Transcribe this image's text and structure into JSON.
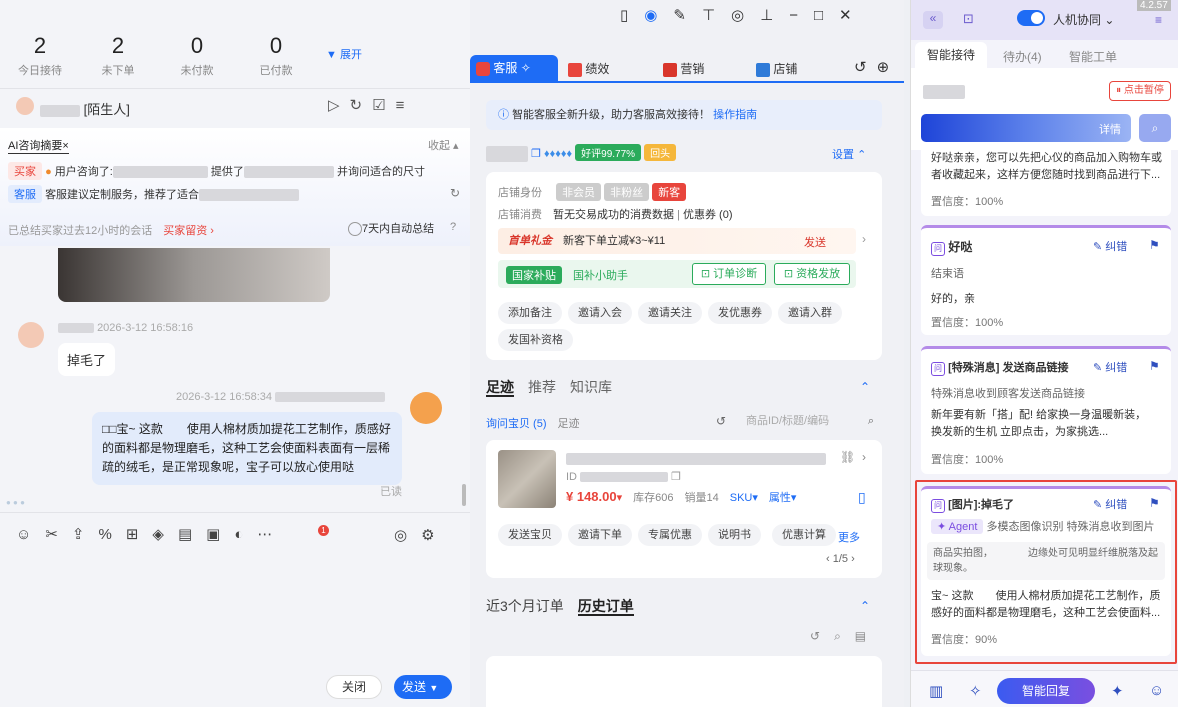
{
  "stats": [
    {
      "value": "2",
      "label": "今日接待"
    },
    {
      "value": "2",
      "label": "未下单"
    },
    {
      "value": "0",
      "label": "未付款"
    },
    {
      "value": "0",
      "label": "已付款"
    }
  ],
  "expand": "展开",
  "customer": {
    "tag": "[陌生人]"
  },
  "ai": {
    "title": "AI咨询摘要",
    "collapse": "收起",
    "buyer_label": "买家",
    "buyer_text1": "用户咨询了:",
    "buyer_text2": "提供了",
    "buyer_text3": "并询问适合的尺寸",
    "service_label": "客服",
    "service_text": "客服建议定制服务，推荐了适合",
    "summary": "已总结买家过去12小时的会话",
    "buyer_msg": "买家留资 ›",
    "auto": "7天内自动总结"
  },
  "chat": {
    "time1": "2026-3-12 16:58:16",
    "msg1": "掉毛了",
    "time2": "2026-3-12 16:58:34",
    "reply": "□□宝~ 这款　　使用人棉材质加提花工艺制作，质感好的面料都是物理磨毛，这种工艺会使面料表面有一层稀疏的绒毛，是正常现象呢，宝子可以放心使用哒",
    "read": "已读",
    "close": "关闭",
    "send": "发送"
  },
  "tabs": [
    "客服",
    "绩效",
    "营销",
    "店铺"
  ],
  "notice": {
    "text": "智能客服全新升级，助力客服高效接待！",
    "link": "操作指南"
  },
  "shop": {
    "rate": "好评99.77%",
    "badge": "回头",
    "settings": "设置"
  },
  "buyer": {
    "identity_label": "店铺身份",
    "identity_tags": [
      "非会员",
      "非粉丝",
      "新客"
    ],
    "consume_label": "店铺消费",
    "consume_value": "暂无交易成功的消费数据",
    "coupon": "优惠券 (0)",
    "gift_title": "首单礼金",
    "gift_desc": "新客下单立减¥3~¥11",
    "gift_send": "发送",
    "subsidy": "国家补贴",
    "subsidy_desc": "国补小助手",
    "diagnose": "订单诊断",
    "grant": "资格发放"
  },
  "actions": [
    "添加备注",
    "邀请入会",
    "邀请关注",
    "发优惠券",
    "邀请入群",
    "发国补资格"
  ],
  "foot_tabs": [
    "足迹",
    "推荐",
    "知识库"
  ],
  "sub_tabs": [
    "询问宝贝 (5)",
    "足迹"
  ],
  "search": {
    "placeholder": "商品ID/标题/编码"
  },
  "product": {
    "id": "ID",
    "price": "¥ 148.00",
    "stock": "库存606",
    "sales": "销量14",
    "sku": "SKU",
    "attr": "属性"
  },
  "product_actions": [
    "发送宝贝",
    "邀请下单",
    "专属优惠",
    "说明书",
    "优惠计算"
  ],
  "more": "更多",
  "pager": "1/5",
  "order_tabs": [
    "近3个月订单",
    "历史订单"
  ],
  "right": {
    "version": "4.2.57",
    "mode": "人机协同",
    "tabs": [
      "智能接待",
      "待办(4)",
      "智能工单"
    ],
    "pause": "点击暂停",
    "detail": "详情",
    "cards": [
      {
        "text": "好哒亲亲，您可以先把心仪的商品加入购物车或者收藏起来，这样方便您随时找到商品进行下...",
        "conf": "置信度：100%"
      },
      {
        "title": "好哒",
        "type": "结束语",
        "text": "好的，亲",
        "conf": "置信度：100%"
      },
      {
        "title": "[特殊消息] 发送商品链接",
        "type": "特殊消息收到顾客发送商品链接",
        "text": "新年要有新「搭」配! 给家换一身温暖新装，　　　　换发新的生机 立即点击，为家挑选...",
        "conf": "置信度：100%"
      },
      {
        "title": "[图片]:掉毛了",
        "agent": "Agent",
        "type": "多模态图像识别 特殊消息收到图片",
        "analysis": "商品实拍图，　　　　边缘处可见明显纤维脱落及起球现象。",
        "text": "宝~ 这款　　使用人棉材质加提花工艺制作，质感好的面料都是物理磨毛，这种工艺会使面料...",
        "conf": "置信度：90%"
      }
    ],
    "correct": "纠错",
    "reply_btn": "智能回复"
  },
  "colors": {
    "accent": "#1e6cf5",
    "red": "#e8453c",
    "purple": "#7b4de0",
    "green": "#2bab5b"
  }
}
